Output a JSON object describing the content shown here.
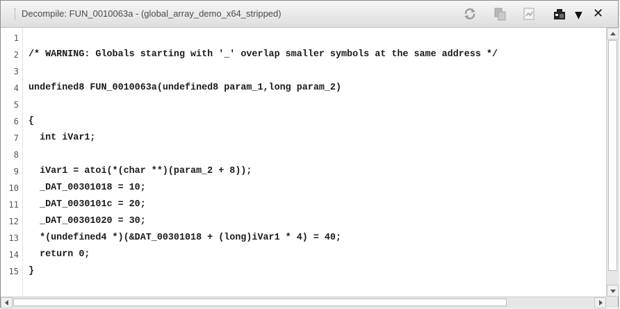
{
  "window": {
    "title": "Decompile: FUN_0010063a -  (global_array_demo_x64_stripped)"
  },
  "toolbar": {
    "icons": [
      "refresh-icon",
      "copy-icon",
      "export-icon",
      "snapshot-icon"
    ],
    "menu_glyph": "▼",
    "close_glyph": "✕"
  },
  "editor": {
    "lines": [
      {
        "num": "1",
        "text": ""
      },
      {
        "num": "2",
        "text": "/* WARNING: Globals starting with '_' overlap smaller symbols at the same address */"
      },
      {
        "num": "3",
        "text": ""
      },
      {
        "num": "4",
        "text": "undefined8 FUN_0010063a(undefined8 param_1,long param_2)"
      },
      {
        "num": "5",
        "text": ""
      },
      {
        "num": "6",
        "text": "{"
      },
      {
        "num": "7",
        "text": "  int iVar1;"
      },
      {
        "num": "8",
        "text": ""
      },
      {
        "num": "9",
        "text": "  iVar1 = atoi(*(char **)(param_2 + 8));"
      },
      {
        "num": "10",
        "text": "  _DAT_00301018 = 10;"
      },
      {
        "num": "11",
        "text": "  _DAT_0030101c = 20;"
      },
      {
        "num": "12",
        "text": "  _DAT_00301020 = 30;"
      },
      {
        "num": "13",
        "text": "  *(undefined4 *)(&DAT_00301018 + (long)iVar1 * 4) = 40;"
      },
      {
        "num": "14",
        "text": "  return 0;"
      },
      {
        "num": "15",
        "text": "}"
      }
    ]
  },
  "scroll": {
    "vertical_position": 0.0,
    "horizontal_position": 0.98
  }
}
